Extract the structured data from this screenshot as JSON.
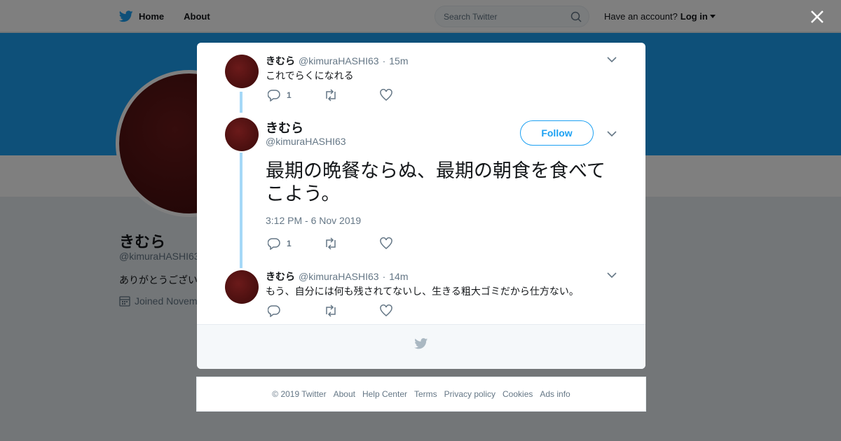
{
  "topbar": {
    "home_label": "Home",
    "about_label": "About",
    "search_placeholder": "Search Twitter",
    "account_prompt": "Have an account?",
    "login_label": "Log in"
  },
  "profile": {
    "name": "きむら",
    "handle": "@kimuraHASHI63",
    "bio": "ありがとうござい",
    "joined": "Joined Novem"
  },
  "colors": {
    "brand_blue": "#1da1f2",
    "thread_line": "#a5d8f7",
    "muted_text": "#657786"
  },
  "tweets": [
    {
      "name": "きむら",
      "handle": "@kimuraHASHI63",
      "separator": "·",
      "time": "15m",
      "text": "これでらくになれる",
      "reply_count": "1",
      "retweet_count": "",
      "like_count": ""
    },
    {
      "name": "きむら",
      "handle": "@kimuraHASHI63",
      "separator": "·",
      "time": "14m",
      "text": "もう、自分には何も残されてないし、生きる粗大ゴミだから仕方ない。",
      "reply_count": "",
      "retweet_count": "",
      "like_count": ""
    }
  ],
  "main_tweet": {
    "name": "きむら",
    "handle": "@kimuraHASHI63",
    "follow_label": "Follow",
    "text": "最期の晩餐ならぬ、最期の朝食を食べてこよう。",
    "date": "3:12 PM - 6 Nov 2019",
    "reply_count": "1",
    "retweet_count": "",
    "like_count": ""
  },
  "icons": [
    "twitter-bird-icon",
    "search-icon",
    "caret-down-icon",
    "close-icon",
    "calendar-icon",
    "chevron-down-icon",
    "reply-icon",
    "retweet-icon",
    "like-icon"
  ],
  "footer": {
    "copyright": "© 2019 Twitter",
    "links": [
      "About",
      "Help Center",
      "Terms",
      "Privacy policy",
      "Cookies",
      "Ads info"
    ]
  }
}
